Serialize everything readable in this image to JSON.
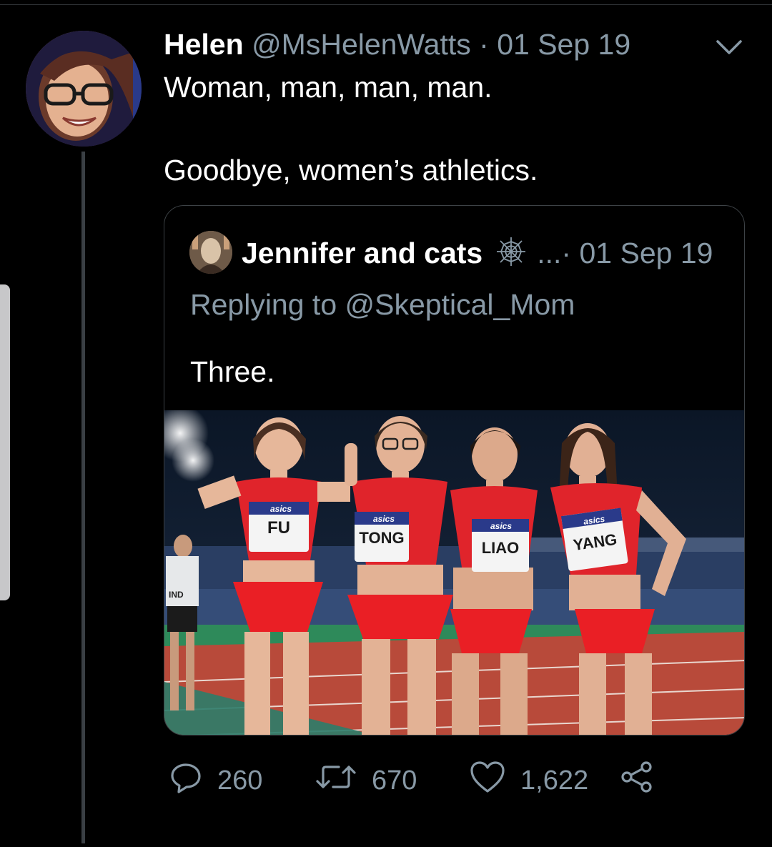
{
  "tweet": {
    "display_name": "Helen",
    "handle": "@MsHelenWatts",
    "separator": "·",
    "date": "01 Sep 19",
    "text_line1": "Woman, man, man, man.",
    "text_line2": "Goodbye, women’s athletics."
  },
  "quoted": {
    "display_name": "Jennifer and cats",
    "handle_truncated": "...",
    "separator": "·",
    "date": "01 Sep 19",
    "replying_to": "Replying to @Skeptical_Mom",
    "text": "Three.",
    "photo": {
      "bibs": [
        "FU",
        "TONG",
        "LIAO",
        "YANG"
      ],
      "sponsor": "asics",
      "side_bib": "IND"
    }
  },
  "actions": {
    "replies": "260",
    "retweets": "670",
    "likes": "1,622"
  },
  "colors": {
    "background": "#000000",
    "muted_text": "#8899a6",
    "primary_text": "#ffffff",
    "border": "#3d4246",
    "jersey_red": "#e0242b"
  },
  "icons": [
    "chevron-down-icon",
    "spider-web-icon",
    "reply-icon",
    "retweet-icon",
    "like-icon",
    "share-icon"
  ]
}
